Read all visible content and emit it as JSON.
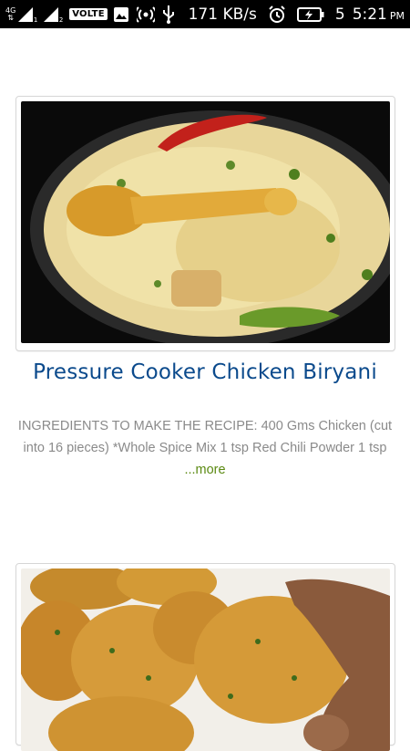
{
  "status_bar": {
    "network_type": "4G",
    "volte_label": "VOLTE",
    "sim1_sub": "1",
    "sim2_sub": "2",
    "speed": "171 KB/s",
    "battery_level": "5",
    "time": "5:21",
    "ampm": "PM"
  },
  "recipes": [
    {
      "title": "Pressure Cooker Chicken Biryani",
      "excerpt": "INGREDIENTS TO MAKE THE RECIPE:   400 Gms Chicken (cut into 16 pieces) *Whole Spice Mix 1 tsp Red Chili Powder 1 tsp",
      "more_label": "...more"
    }
  ],
  "colors": {
    "title": "#0b4a8c",
    "more": "#5b8a12",
    "excerpt": "#8a8a8a"
  }
}
